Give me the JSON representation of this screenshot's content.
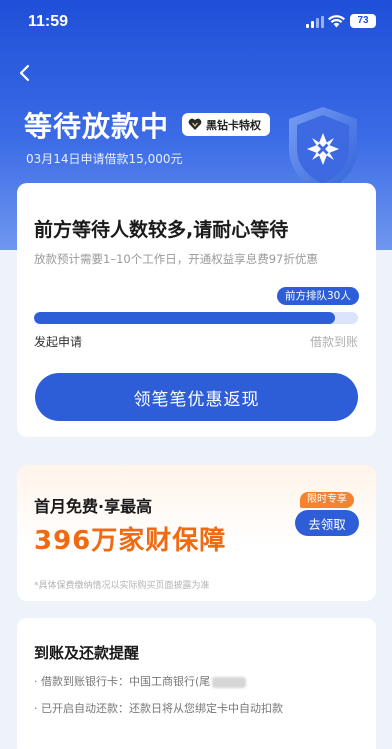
{
  "status_bar": {
    "time": "11:59",
    "battery": "73"
  },
  "header": {
    "title": "等待放款中",
    "vip_badge": "黑钻卡特权",
    "subtitle": "03月14日申请借款15,000元"
  },
  "queue_card": {
    "title": "前方等待人数较多,请耐心等待",
    "description": "放款预计需要1–10个工作日，开通权益享息费97折优惠",
    "queue_badge": "前方排队30人",
    "progress": 0.93,
    "step_start": "发起申请",
    "step_end": "借款到账",
    "cta_label": "领笔笔优惠返现"
  },
  "promo_card": {
    "title": "首月免费·享最高",
    "highlight": "396万家财保障",
    "tag": "限时专享",
    "claim_label": "去领取",
    "note": "*具体保费缴纳情况以实际购买页面披露为准"
  },
  "reminder_card": {
    "title": "到账及还款提醒",
    "rows": [
      "· 借款到账银行卡：中国工商银行(尾",
      "· 已开启自动还款：还款日将从您绑定卡中自动扣款"
    ]
  },
  "colors": {
    "brand_blue": "#2d5ed8",
    "accent_orange": "#f06a12"
  }
}
